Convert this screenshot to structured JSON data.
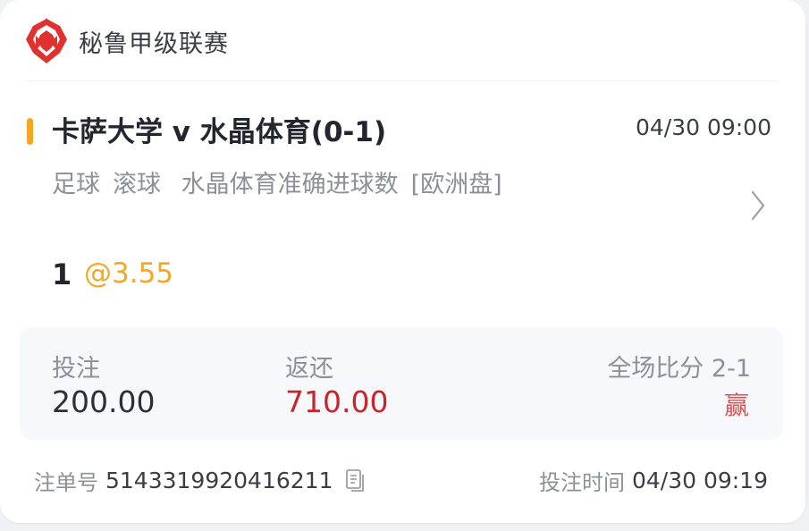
{
  "league": {
    "name": "秘鲁甲级联赛",
    "logo_icon": "peru-league-logo-icon",
    "logo_color": "#e0312f"
  },
  "match": {
    "title": "卡萨大学 v 水晶体育(0-1)",
    "time": "04/30 09:00",
    "accent_color": "#f5a623"
  },
  "bet": {
    "sport": "足球",
    "type": "滚球",
    "market": "水晶体育准确进球数",
    "odds_format": "[欧洲盘]",
    "pick": "1",
    "odds": "@3.55"
  },
  "summary": {
    "stake_label": "投注",
    "stake_value": "200.00",
    "return_label": "返还",
    "return_value": "710.00",
    "score_label": "全场比分 2-1",
    "result": "赢"
  },
  "footer": {
    "order_label": "注单号",
    "order_number": "5143319920416211",
    "bet_time_label": "投注时间",
    "bet_time_value": "04/30 09:19"
  },
  "colors": {
    "return_red": "#c8252b",
    "result_red": "#d9534f",
    "odds_orange": "#f5a623"
  }
}
